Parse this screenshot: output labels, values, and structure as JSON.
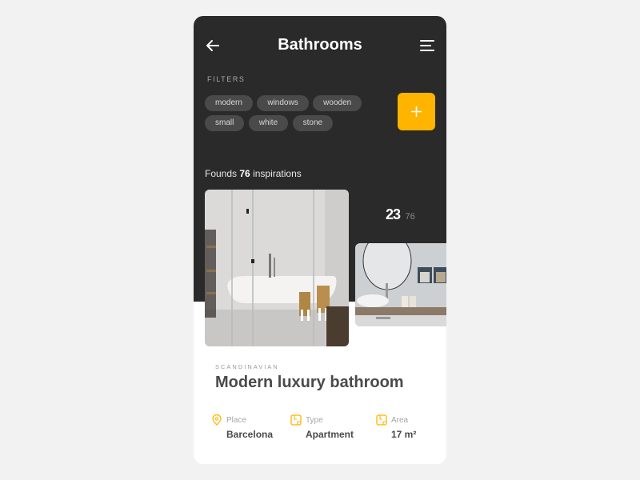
{
  "header": {
    "title": "Bathrooms",
    "back_icon": "arrow-left-icon",
    "menu_icon": "menu-lines-icon"
  },
  "filters": {
    "label": "FILTERS",
    "chips": [
      "modern",
      "windows",
      "wooden",
      "small",
      "white",
      "stone"
    ],
    "add_button_icon": "plus-icon",
    "accent_color": "#ffb400"
  },
  "results": {
    "prefix": "Founds",
    "count": "76",
    "suffix": "inspirations"
  },
  "pager": {
    "current": "23",
    "total": "76"
  },
  "card": {
    "category": "SCANDINAVIAN",
    "title": "Modern luxury bathroom",
    "details": [
      {
        "icon": "location-pin-icon",
        "label": "Place",
        "value": "Barcelona"
      },
      {
        "icon": "floorplan-icon",
        "label": "Type",
        "value": "Apartment"
      },
      {
        "icon": "floorplan-icon",
        "label": "Area",
        "value": "17 m²"
      }
    ]
  },
  "colors": {
    "dark_background": "#2a2a2a",
    "chip_background": "#4a4a4a",
    "accent": "#ffb400",
    "page_background": "#f2f2f2"
  }
}
